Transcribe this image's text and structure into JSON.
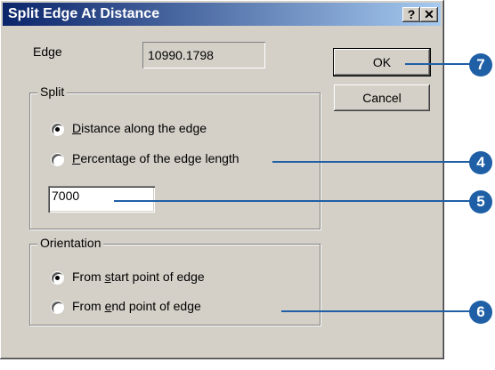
{
  "window": {
    "title": "Split Edge At Distance",
    "help_glyph": "?",
    "close_glyph": "✕"
  },
  "edge": {
    "label": "Edge",
    "value": "10990.1798"
  },
  "buttons": {
    "ok": "OK",
    "cancel": "Cancel"
  },
  "split": {
    "title": "Split",
    "options": [
      {
        "label_pre": "",
        "accel": "D",
        "label_post": "istance along the edge",
        "selected": true
      },
      {
        "label_pre": "",
        "accel": "P",
        "label_post": "ercentage of the edge length",
        "selected": false
      }
    ],
    "value": "7000"
  },
  "orientation": {
    "title": "Orientation",
    "options": [
      {
        "label_pre": "From ",
        "accel": "s",
        "label_post": "tart point of edge",
        "selected": true
      },
      {
        "label_pre": "From ",
        "accel": "e",
        "label_post": "nd point of edge",
        "selected": false
      }
    ]
  },
  "callouts": [
    "7",
    "4",
    "5",
    "6"
  ],
  "colors": {
    "callout": "#1f5fa6",
    "titlebar_start": "#0a246a",
    "titlebar_end": "#a6caf0"
  }
}
